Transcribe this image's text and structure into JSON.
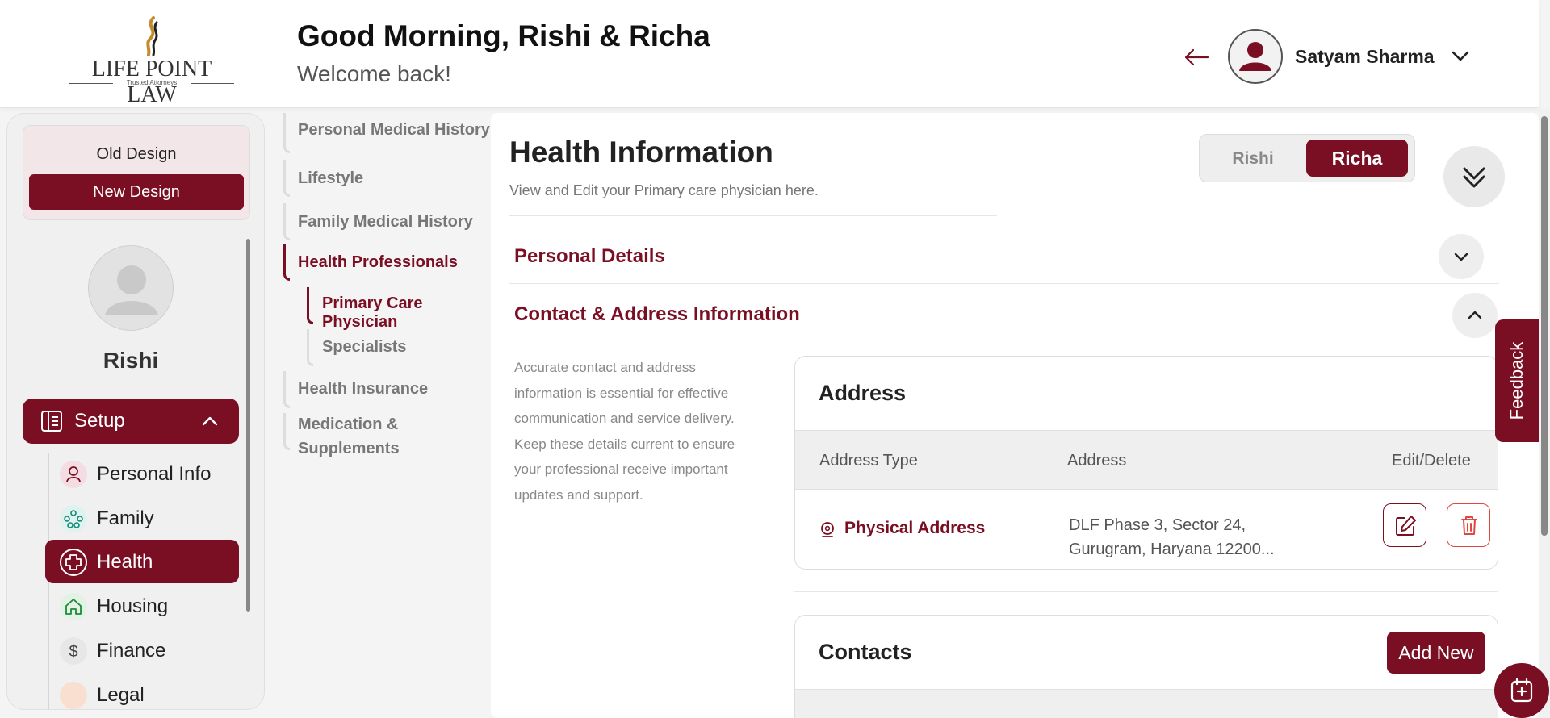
{
  "brand": {
    "name": "LIFE POINT LAW",
    "tagline": "Trusted Attorneys"
  },
  "header": {
    "greeting": "Good Morning, Rishi & Richa",
    "welcome": "Welcome back!",
    "user_name": "Satyam Sharma"
  },
  "sidebar": {
    "old_design": "Old Design",
    "new_design": "New Design",
    "profile_name": "Rishi",
    "setup_label": "Setup",
    "items": [
      {
        "label": "Personal Info",
        "icon": "person-icon"
      },
      {
        "label": "Family",
        "icon": "family-icon"
      },
      {
        "label": "Health",
        "icon": "health-plus-icon",
        "active": true
      },
      {
        "label": "Housing",
        "icon": "house-icon"
      },
      {
        "label": "Finance",
        "icon": "dollar-icon"
      },
      {
        "label": "Legal",
        "icon": "legal-icon"
      }
    ]
  },
  "subnav": {
    "items": [
      {
        "label": "Personal Medical History"
      },
      {
        "label": "Lifestyle"
      },
      {
        "label": "Family Medical History"
      },
      {
        "label": "Health Professionals",
        "active": true
      },
      {
        "label": "Primary Care Physician",
        "active": true
      },
      {
        "label": "Specialists"
      },
      {
        "label": "Health Insurance"
      },
      {
        "label": "Medication &"
      },
      {
        "label": "Supplements"
      }
    ]
  },
  "main": {
    "title": "Health Information",
    "subtitle": "View and Edit your Primary care physician here.",
    "toggle": {
      "option_1": "Rishi",
      "option_2": "Richa",
      "selected": "Richa"
    },
    "sections": {
      "personal_details": "Personal Details",
      "contact_address": "Contact & Address Information"
    },
    "contact_description": "Accurate contact and address information is essential for effective communication and service delivery. Keep these details current to ensure your professional receive important updates and support.",
    "address_card": {
      "title": "Address",
      "columns": [
        "Address Type",
        "Address",
        "Edit/Delete"
      ],
      "rows": [
        {
          "type": "Physical Address",
          "address_line1": "DLF Phase 3, Sector 24,",
          "address_line2": "Gurugram, Haryana 12200..."
        }
      ]
    },
    "contacts_card": {
      "title": "Contacts",
      "add_new": "Add New"
    }
  },
  "feedback": "Feedback",
  "colors": {
    "brand": "#7a0f24",
    "background": "#f4f4f4"
  }
}
